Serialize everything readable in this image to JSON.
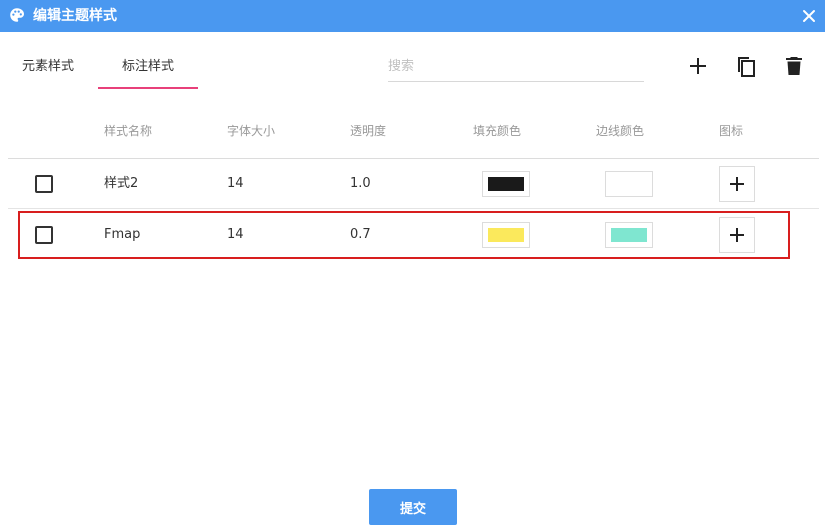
{
  "window": {
    "title": "编辑主题样式",
    "title_icon": "palette-icon",
    "close_icon": "close-icon"
  },
  "tabs": [
    {
      "label": "元素样式",
      "active": false
    },
    {
      "label": "标注样式",
      "active": true
    }
  ],
  "search": {
    "placeholder": "搜索",
    "value": ""
  },
  "toolbar": {
    "add_icon": "plus-icon",
    "copy_icon": "copy-icon",
    "delete_icon": "trash-icon"
  },
  "table": {
    "columns": [
      "样式名称",
      "字体大小",
      "透明度",
      "填充颜色",
      "边线颜色",
      "图标"
    ],
    "rows": [
      {
        "name": "样式2",
        "font_size": "14",
        "opacity": "1.0",
        "fill_color": "#1a1a1a",
        "border_color": "#ffffff",
        "icon": "plus-icon",
        "checked": false
      },
      {
        "name": "Fmap",
        "font_size": "14",
        "opacity": "0.7",
        "fill_color": "#fbe95c",
        "border_color": "#7fe6d0",
        "icon": "plus-icon",
        "checked": false,
        "highlighted": true
      }
    ]
  },
  "colors": {
    "titlebar": "#4a98f0",
    "tab_underline": "#e8407a",
    "highlight_border": "#d81e1e",
    "submit_button": "#4a98f0"
  },
  "footer": {
    "submit_label": "提交"
  }
}
